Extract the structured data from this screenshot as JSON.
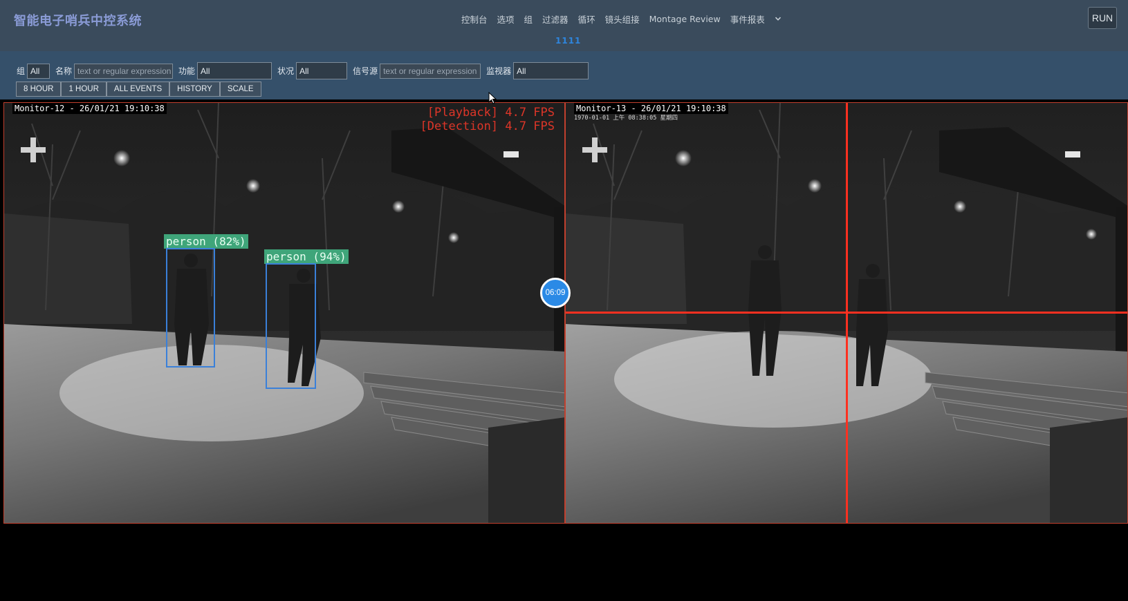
{
  "header": {
    "brand": "智能电子哨兵中控系统",
    "nav": [
      "控制台",
      "选项",
      "组",
      "过滤器",
      "循环",
      "镜头组接",
      "Montage Review",
      "事件报表"
    ],
    "subtitle": "1111",
    "run_label": "RUN"
  },
  "filters": {
    "group_label": "组",
    "group_value": "All",
    "name_label": "名称",
    "name_placeholder": "text or regular expression",
    "function_label": "功能",
    "function_value": "All",
    "status_label": "状况",
    "status_value": "All",
    "source_label": "信号源",
    "source_placeholder": "text or regular expression",
    "monitor_label": "监视器",
    "monitor_value": "All",
    "quick_buttons": [
      "8 HOUR",
      "1 HOUR",
      "ALL EVENTS",
      "HISTORY",
      "SCALE"
    ]
  },
  "monitors": [
    {
      "caption": "Monitor-12 - 26/01/21 19:10:38",
      "fps_lines": [
        "[Playback] 4.7 FPS",
        "[Detection] 4.7 FPS"
      ],
      "detections": [
        {
          "label": "person (82%)"
        },
        {
          "label": "person (94%)"
        }
      ]
    },
    {
      "caption": "Monitor-13 - 26/01/21 19:10:38",
      "osd": "1970-01-01 上午 08:38:05 星期四"
    }
  ],
  "timer": "06:09",
  "colors": {
    "header_bg": "#3a4b5c",
    "filter_bg": "#35506a",
    "brand": "#8a9bd6",
    "accent": "#2e86de",
    "alarm_red": "#ff3020",
    "detection_green": "#3fa57a"
  }
}
